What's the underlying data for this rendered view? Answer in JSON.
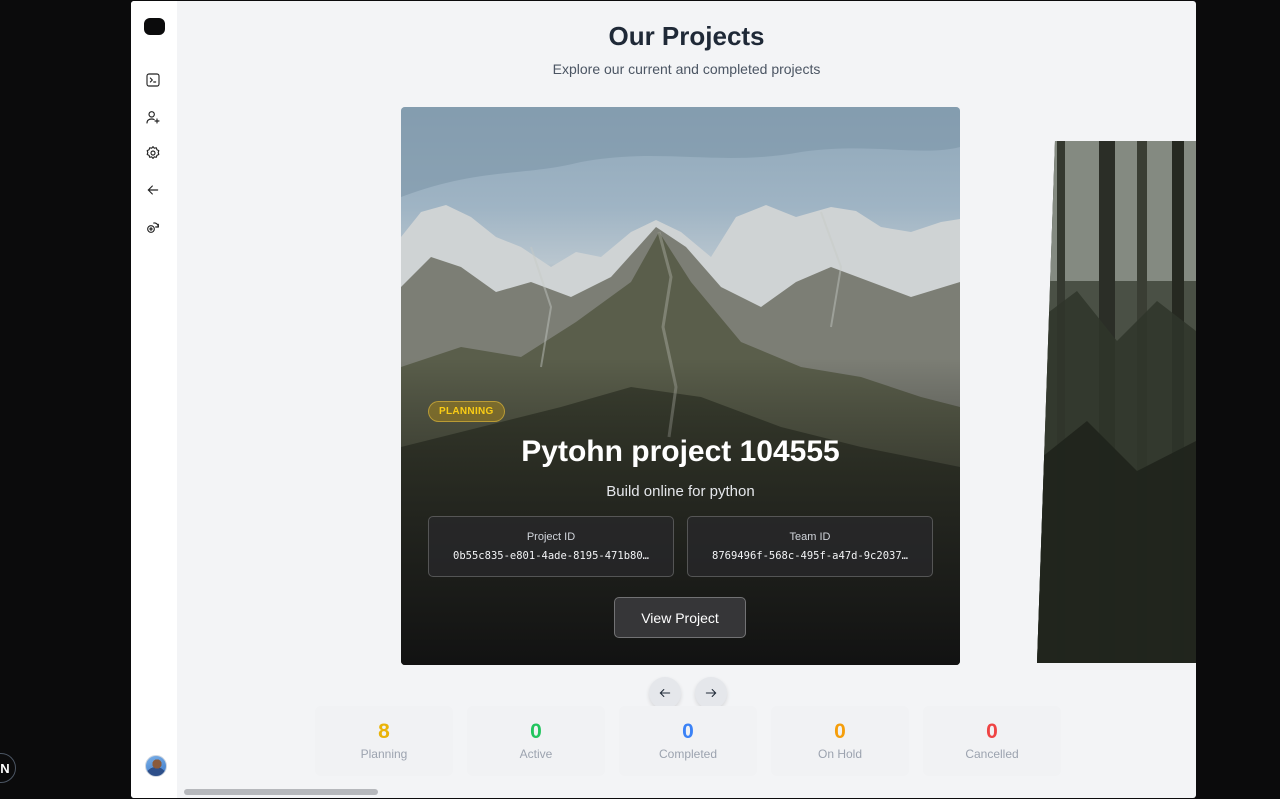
{
  "header": {
    "title": "Our Projects",
    "subtitle": "Explore our current and completed projects"
  },
  "sidebar": {
    "items": [
      {
        "icon": "terminal-icon"
      },
      {
        "icon": "user-plus-icon"
      },
      {
        "icon": "settings-gear-icon"
      },
      {
        "icon": "arrow-left-icon"
      },
      {
        "icon": "switch-icon"
      }
    ]
  },
  "project": {
    "status": "PLANNING",
    "title": "Pytohn project 104555",
    "description": "Build online for python",
    "project_id_label": "Project ID",
    "project_id": "0b55c835-e801-4ade-8195-471b80…",
    "team_id_label": "Team ID",
    "team_id": "8769496f-568c-495f-a47d-9c2037…",
    "view_button": "View Project"
  },
  "stats": [
    {
      "count": "8",
      "label": "Planning",
      "color": "#eab308"
    },
    {
      "count": "0",
      "label": "Active",
      "color": "#22c55e"
    },
    {
      "count": "0",
      "label": "Completed",
      "color": "#3b82f6"
    },
    {
      "count": "0",
      "label": "On Hold",
      "color": "#f59e0b"
    },
    {
      "count": "0",
      "label": "Cancelled",
      "color": "#ef4444"
    }
  ],
  "colors": {
    "badge_text": "#facc15",
    "title_text": "#1f2937"
  }
}
